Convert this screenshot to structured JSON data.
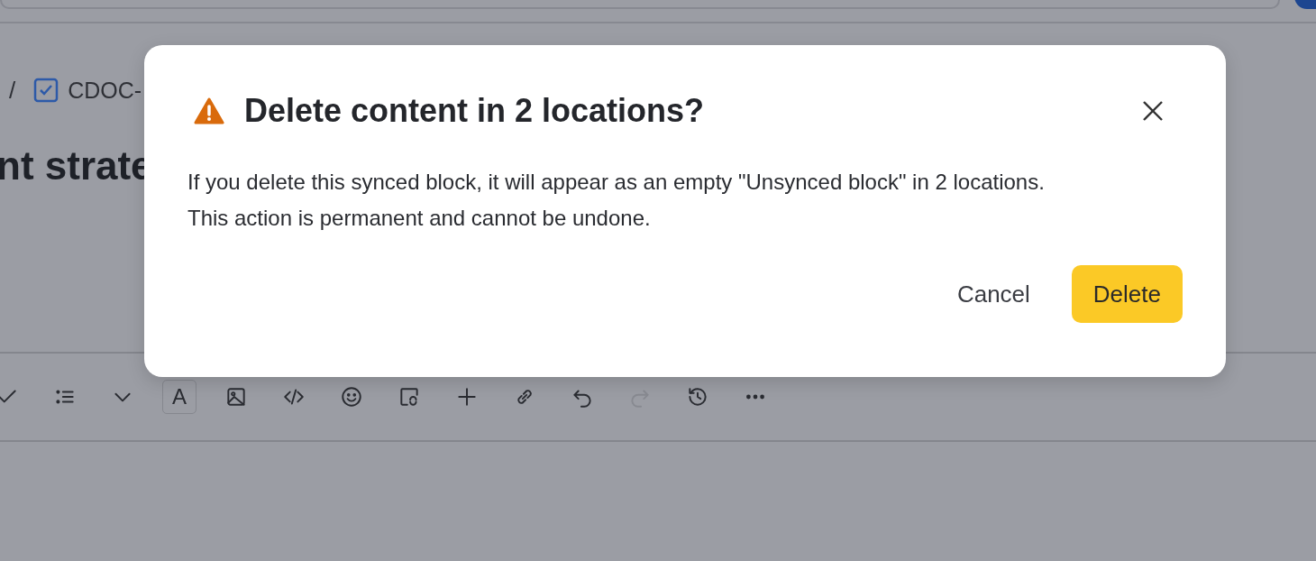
{
  "background": {
    "breadcrumb": {
      "separator": "/",
      "item": "CDOC-"
    },
    "page_title": "nt strate",
    "toolbar": [
      {
        "kind": "check",
        "disabled": false
      },
      {
        "kind": "list",
        "disabled": false
      },
      {
        "kind": "chevron",
        "disabled": false
      },
      {
        "kind": "text-style",
        "label": "A",
        "disabled": false
      },
      {
        "kind": "image",
        "disabled": false
      },
      {
        "kind": "code",
        "disabled": false
      },
      {
        "kind": "emoji",
        "disabled": false
      },
      {
        "kind": "sync",
        "disabled": false
      },
      {
        "kind": "plus",
        "disabled": false
      },
      {
        "kind": "link",
        "disabled": false
      },
      {
        "kind": "undo",
        "disabled": false
      },
      {
        "kind": "redo",
        "disabled": true
      },
      {
        "kind": "history",
        "disabled": false
      },
      {
        "kind": "more",
        "disabled": false
      }
    ]
  },
  "dialog": {
    "title": "Delete content in 2 locations?",
    "message": "If you delete this synced block, it will appear as an empty \"Unsynced block\" in 2 locations. This action is permanent and cannot be undone.",
    "buttons": [
      {
        "label": "Cancel",
        "kind": "secondary"
      },
      {
        "label": "Delete",
        "kind": "primary"
      }
    ]
  }
}
